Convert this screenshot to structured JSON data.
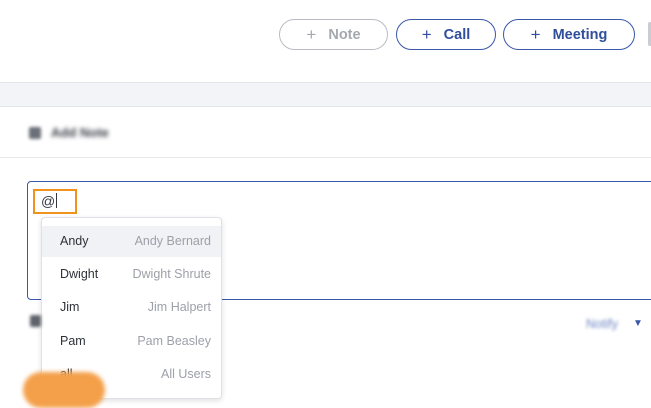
{
  "toolbar": {
    "note_label": "Note",
    "call_label": "Call",
    "meeting_label": "Meeting",
    "plus_glyph": "+"
  },
  "note_panel": {
    "header_label": "Add Note"
  },
  "editor": {
    "value": "@"
  },
  "mention_options": [
    {
      "short": "Andy",
      "full": "Andy Bernard",
      "highlighted": true
    },
    {
      "short": "Dwight",
      "full": "Dwight Shrute",
      "highlighted": false
    },
    {
      "short": "Jim",
      "full": "Jim Halpert",
      "highlighted": false
    },
    {
      "short": "Pam",
      "full": "Pam Beasley",
      "highlighted": false
    },
    {
      "short": "all",
      "full": "All Users",
      "highlighted": false
    }
  ],
  "footer": {
    "notify_label": "Notify",
    "notify_caret": "▼"
  },
  "colors": {
    "accent": "#3a57a8",
    "highlight": "#f0921e",
    "submit": "#f4a04a",
    "disabled": "#a4a8b0"
  }
}
